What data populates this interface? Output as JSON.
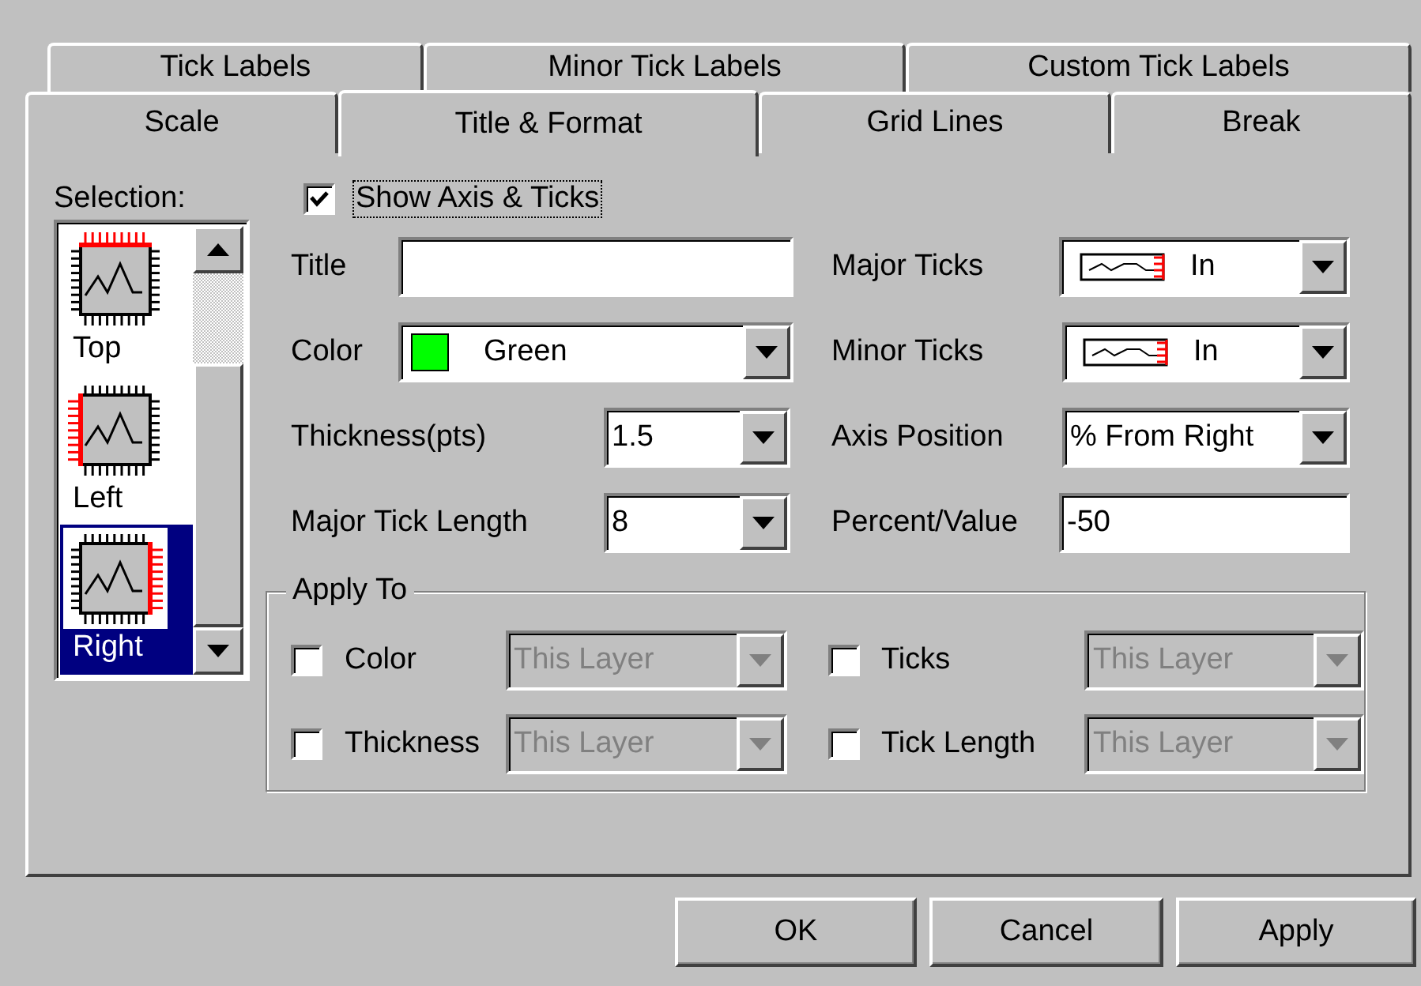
{
  "tabs_back": [
    {
      "label": "Tick Labels",
      "selected": false
    },
    {
      "label": "Minor Tick Labels",
      "selected": false
    },
    {
      "label": "Custom Tick Labels",
      "selected": false
    }
  ],
  "tabs_front": [
    {
      "label": "Scale",
      "selected": false
    },
    {
      "label": "Title & Format",
      "selected": true
    },
    {
      "label": "Grid Lines",
      "selected": false
    },
    {
      "label": "Break",
      "selected": false
    }
  ],
  "selection": {
    "label": "Selection:",
    "items": [
      {
        "label": "Top",
        "kind": "top",
        "selected": false
      },
      {
        "label": "Left",
        "kind": "left",
        "selected": false
      },
      {
        "label": "Right",
        "kind": "right",
        "selected": true
      }
    ]
  },
  "show_axis": {
    "label": "Show Axis & Ticks",
    "checked": true
  },
  "left_fields": [
    {
      "kind": "text",
      "label": "Title"
    },
    {
      "kind": "combo",
      "label": "Color",
      "value": "Green",
      "color": "#00ff00"
    },
    {
      "kind": "combo",
      "label": "Thickness(pts)",
      "value": "1.5"
    },
    {
      "kind": "combo",
      "label": "Major Tick Length",
      "value": "8"
    }
  ],
  "right_fields": [
    {
      "kind": "tick-combo",
      "label": "Major Ticks",
      "value": "In"
    },
    {
      "kind": "tick-combo",
      "label": "Minor Ticks",
      "value": "In"
    },
    {
      "kind": "combo",
      "label": "Axis Position",
      "value": "% From Right"
    },
    {
      "kind": "text",
      "label": "Percent/Value",
      "value": "-50"
    }
  ],
  "apply_to": {
    "label": "Apply To",
    "rows": [
      {
        "label": "Color",
        "checked": false,
        "value": "This Layer",
        "disabled": true
      },
      {
        "label": "Ticks",
        "checked": false,
        "value": "This Layer",
        "disabled": true
      },
      {
        "label": "Thickness",
        "checked": false,
        "value": "This Layer",
        "disabled": true
      },
      {
        "label": "Tick Length",
        "checked": false,
        "value": "This Layer",
        "disabled": true
      }
    ]
  },
  "buttons": [
    "OK",
    "Cancel",
    "Apply"
  ]
}
